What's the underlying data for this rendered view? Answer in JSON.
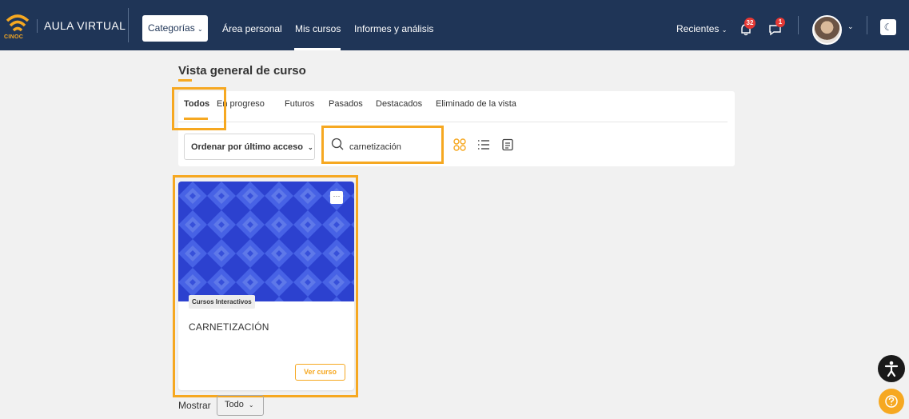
{
  "navbar": {
    "logo_text": "CINOC",
    "app_title": "AULA VIRTUAL",
    "categories_label": "Categorías",
    "links": [
      "Área personal",
      "Mis cursos",
      "Informes y análisis"
    ],
    "recientes_label": "Recientes",
    "notifications_count": "32",
    "messages_count": "1"
  },
  "main": {
    "section_title": "Vista general de curso",
    "tabs": [
      "Todos",
      "En progreso",
      "Futuros",
      "Pasados",
      "Destacados",
      "Eliminado de la vista"
    ],
    "sort_label": "Ordenar por último acceso",
    "search_value": "carnetización"
  },
  "course_card": {
    "category": "Cursos Interactivos",
    "title": "CARNETIZACIÓN",
    "menu_label": "···",
    "button_label": "Ver curso"
  },
  "pagination": {
    "show_label": "Mostrar",
    "show_value": "Todo"
  },
  "colors": {
    "navbar": "#1f3557",
    "accent": "#f6a821",
    "badge": "#e53935",
    "card_pattern": "#3a55e8"
  }
}
